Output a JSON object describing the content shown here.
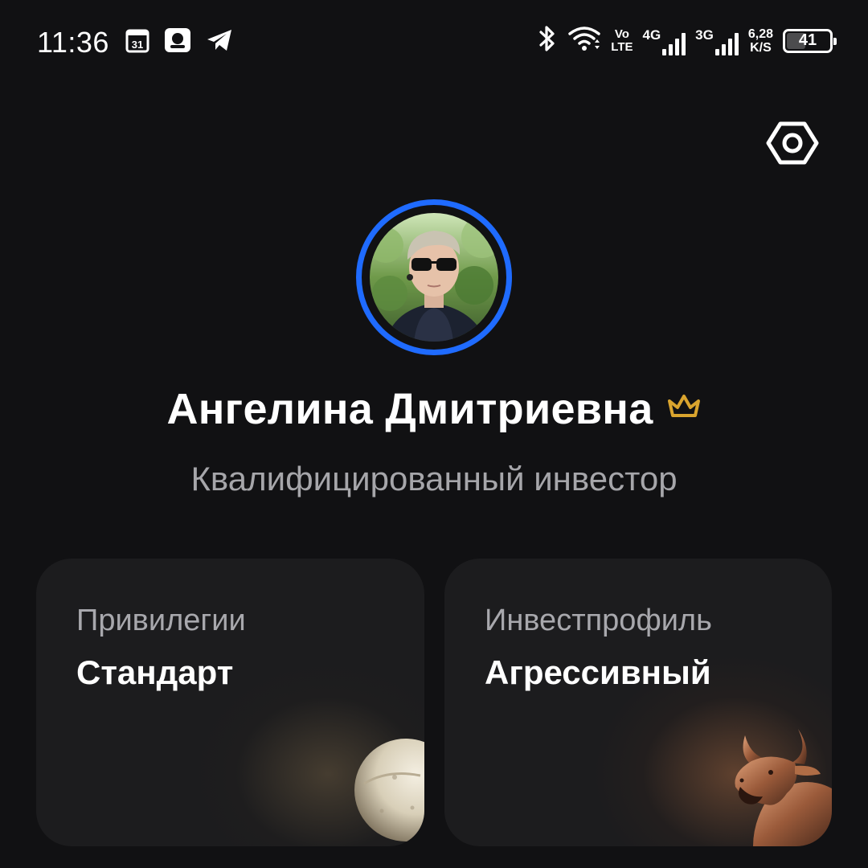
{
  "status_bar": {
    "time": "11:36",
    "calendar_day": "31",
    "net1_label": "4G",
    "net2_label": "3G",
    "volte_top": "Vo",
    "volte_bottom": "LTE",
    "speed_value": "6,28",
    "speed_unit": "K/S",
    "battery_level": "41",
    "icons": [
      "calendar-icon",
      "notification-icon",
      "telegram-icon",
      "bluetooth-icon",
      "wifi-icon",
      "signal-icon",
      "battery-icon"
    ]
  },
  "header": {
    "settings_icon": "settings-icon"
  },
  "profile": {
    "name": "Ангелина Дмитриевна",
    "badge_icon": "crown-icon",
    "status": "Квалифицированный инвестор",
    "ring_color": "#1f6bff"
  },
  "cards": [
    {
      "label": "Привилегии",
      "value": "Стандарт",
      "figure": "chess-pawn"
    },
    {
      "label": "Инвестпрофиль",
      "value": "Агрессивный",
      "figure": "bull"
    }
  ],
  "colors": {
    "background": "#111113",
    "card": "#1c1c1e",
    "accent": "#1f6bff",
    "crown": "#d9a42e",
    "muted_text": "#a6a6aa"
  }
}
